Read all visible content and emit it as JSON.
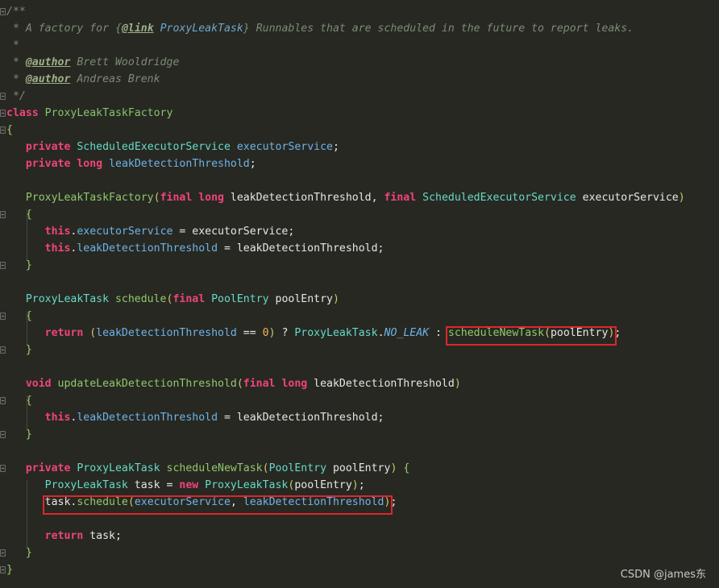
{
  "watermark": "CSDN @james东",
  "lines": [
    [
      {
        "t": "/**",
        "c": "cm"
      }
    ],
    [
      {
        "t": " * A factory for ",
        "c": "cm"
      },
      {
        "t": "{",
        "c": "cm"
      },
      {
        "t": "@link",
        "c": "cmtag"
      },
      {
        "t": " ProxyLeakTask",
        "c": "cmlink"
      },
      {
        "t": "}",
        "c": "cm"
      },
      {
        "t": " Runnables that are scheduled in the future to report leaks.",
        "c": "cm"
      }
    ],
    [
      {
        "t": " *",
        "c": "cm"
      }
    ],
    [
      {
        "t": " * ",
        "c": "cm"
      },
      {
        "t": "@author",
        "c": "cmtag"
      },
      {
        "t": " Brett Wooldridge",
        "c": "cm"
      }
    ],
    [
      {
        "t": " * ",
        "c": "cm"
      },
      {
        "t": "@author",
        "c": "cmtag"
      },
      {
        "t": " Andreas Brenk",
        "c": "cm"
      }
    ],
    [
      {
        "t": " */",
        "c": "cm"
      }
    ],
    [
      {
        "t": "class ",
        "c": "kw"
      },
      {
        "t": "ProxyLeakTaskFactory",
        "c": "cls"
      }
    ],
    [
      {
        "t": "{",
        "c": "br"
      }
    ],
    [
      {
        "t": "   ",
        "c": "plain"
      },
      {
        "t": "private ",
        "c": "kw"
      },
      {
        "t": "ScheduledExecutorService ",
        "c": "tp"
      },
      {
        "t": "executorService",
        "c": "fld"
      },
      {
        "t": ";",
        "c": "op"
      }
    ],
    [
      {
        "t": "   ",
        "c": "plain"
      },
      {
        "t": "private ",
        "c": "kw"
      },
      {
        "t": "long ",
        "c": "kw"
      },
      {
        "t": "leakDetectionThreshold",
        "c": "fld"
      },
      {
        "t": ";",
        "c": "op"
      }
    ],
    [],
    [
      {
        "t": "   ",
        "c": "plain"
      },
      {
        "t": "ProxyLeakTaskFactory",
        "c": "fn"
      },
      {
        "t": "(",
        "c": "par"
      },
      {
        "t": "final ",
        "c": "kw"
      },
      {
        "t": "long ",
        "c": "kw"
      },
      {
        "t": "leakDetectionThreshold, ",
        "c": "plain"
      },
      {
        "t": "final ",
        "c": "kw"
      },
      {
        "t": "ScheduledExecutorService ",
        "c": "tp"
      },
      {
        "t": "executorService",
        "c": "plain"
      },
      {
        "t": ")",
        "c": "par"
      }
    ],
    [
      {
        "t": "   ",
        "c": "plain"
      },
      {
        "t": "{",
        "c": "br"
      }
    ],
    [
      {
        "t": "      ",
        "c": "plain"
      },
      {
        "t": "this",
        "c": "kw"
      },
      {
        "t": ".",
        "c": "op"
      },
      {
        "t": "executorService",
        "c": "fld"
      },
      {
        "t": " = executorService;",
        "c": "plain"
      }
    ],
    [
      {
        "t": "      ",
        "c": "plain"
      },
      {
        "t": "this",
        "c": "kw"
      },
      {
        "t": ".",
        "c": "op"
      },
      {
        "t": "leakDetectionThreshold",
        "c": "fld"
      },
      {
        "t": " = leakDetectionThreshold;",
        "c": "plain"
      }
    ],
    [
      {
        "t": "   ",
        "c": "plain"
      },
      {
        "t": "}",
        "c": "br"
      }
    ],
    [],
    [
      {
        "t": "   ",
        "c": "plain"
      },
      {
        "t": "ProxyLeakTask ",
        "c": "tp"
      },
      {
        "t": "schedule",
        "c": "fn"
      },
      {
        "t": "(",
        "c": "par"
      },
      {
        "t": "final ",
        "c": "kw"
      },
      {
        "t": "PoolEntry ",
        "c": "tp"
      },
      {
        "t": "poolEntry",
        "c": "plain"
      },
      {
        "t": ")",
        "c": "par"
      }
    ],
    [
      {
        "t": "   ",
        "c": "plain"
      },
      {
        "t": "{",
        "c": "br"
      }
    ],
    [
      {
        "t": "      ",
        "c": "plain"
      },
      {
        "t": "return ",
        "c": "kw"
      },
      {
        "t": "(",
        "c": "par"
      },
      {
        "t": "leakDetectionThreshold",
        "c": "fld"
      },
      {
        "t": " == ",
        "c": "op"
      },
      {
        "t": "0",
        "c": "num"
      },
      {
        "t": ") ",
        "c": "par"
      },
      {
        "t": "? ",
        "c": "op"
      },
      {
        "t": "ProxyLeakTask",
        "c": "tp"
      },
      {
        "t": ".",
        "c": "op"
      },
      {
        "t": "NO_LEAK",
        "c": "fldi"
      },
      {
        "t": " : ",
        "c": "op"
      },
      {
        "t": "scheduleNewTask",
        "c": "fn"
      },
      {
        "t": "(",
        "c": "par"
      },
      {
        "t": "poolEntry",
        "c": "plain"
      },
      {
        "t": ")",
        "c": "par"
      },
      {
        "t": ";",
        "c": "op"
      }
    ],
    [
      {
        "t": "   ",
        "c": "plain"
      },
      {
        "t": "}",
        "c": "br"
      }
    ],
    [],
    [
      {
        "t": "   ",
        "c": "plain"
      },
      {
        "t": "void ",
        "c": "kw"
      },
      {
        "t": "updateLeakDetectionThreshold",
        "c": "fn"
      },
      {
        "t": "(",
        "c": "par"
      },
      {
        "t": "final ",
        "c": "kw"
      },
      {
        "t": "long ",
        "c": "kw"
      },
      {
        "t": "leakDetectionThreshold",
        "c": "plain"
      },
      {
        "t": ")",
        "c": "par"
      }
    ],
    [
      {
        "t": "   ",
        "c": "plain"
      },
      {
        "t": "{",
        "c": "br"
      }
    ],
    [
      {
        "t": "      ",
        "c": "plain"
      },
      {
        "t": "this",
        "c": "kw"
      },
      {
        "t": ".",
        "c": "op"
      },
      {
        "t": "leakDetectionThreshold",
        "c": "fld"
      },
      {
        "t": " = leakDetectionThreshold;",
        "c": "plain"
      }
    ],
    [
      {
        "t": "   ",
        "c": "plain"
      },
      {
        "t": "}",
        "c": "br"
      }
    ],
    [],
    [
      {
        "t": "   ",
        "c": "plain"
      },
      {
        "t": "private ",
        "c": "kw"
      },
      {
        "t": "ProxyLeakTask ",
        "c": "tp"
      },
      {
        "t": "scheduleNewTask",
        "c": "fn"
      },
      {
        "t": "(",
        "c": "par"
      },
      {
        "t": "PoolEntry ",
        "c": "tp"
      },
      {
        "t": "poolEntry",
        "c": "plain"
      },
      {
        "t": ") ",
        "c": "par"
      },
      {
        "t": "{",
        "c": "br"
      }
    ],
    [
      {
        "t": "      ",
        "c": "plain"
      },
      {
        "t": "ProxyLeakTask ",
        "c": "tp"
      },
      {
        "t": "task = ",
        "c": "plain"
      },
      {
        "t": "new ",
        "c": "kw"
      },
      {
        "t": "ProxyLeakTask",
        "c": "tp"
      },
      {
        "t": "(",
        "c": "par"
      },
      {
        "t": "poolEntry",
        "c": "plain"
      },
      {
        "t": ")",
        "c": "par"
      },
      {
        "t": ";",
        "c": "op"
      }
    ],
    [
      {
        "t": "      ",
        "c": "plain"
      },
      {
        "t": "task",
        "c": "plain"
      },
      {
        "t": ".",
        "c": "op"
      },
      {
        "t": "schedule",
        "c": "fn"
      },
      {
        "t": "(",
        "c": "par"
      },
      {
        "t": "executorService",
        "c": "fld"
      },
      {
        "t": ", ",
        "c": "op"
      },
      {
        "t": "leakDetectionThreshold",
        "c": "fld"
      },
      {
        "t": ")",
        "c": "par"
      },
      {
        "t": ";",
        "c": "op"
      }
    ],
    [],
    [
      {
        "t": "      ",
        "c": "plain"
      },
      {
        "t": "return ",
        "c": "kw"
      },
      {
        "t": "task;",
        "c": "plain"
      }
    ],
    [
      {
        "t": "   ",
        "c": "plain"
      },
      {
        "t": "}",
        "c": "br"
      }
    ],
    [
      {
        "t": "}",
        "c": "br"
      }
    ]
  ]
}
